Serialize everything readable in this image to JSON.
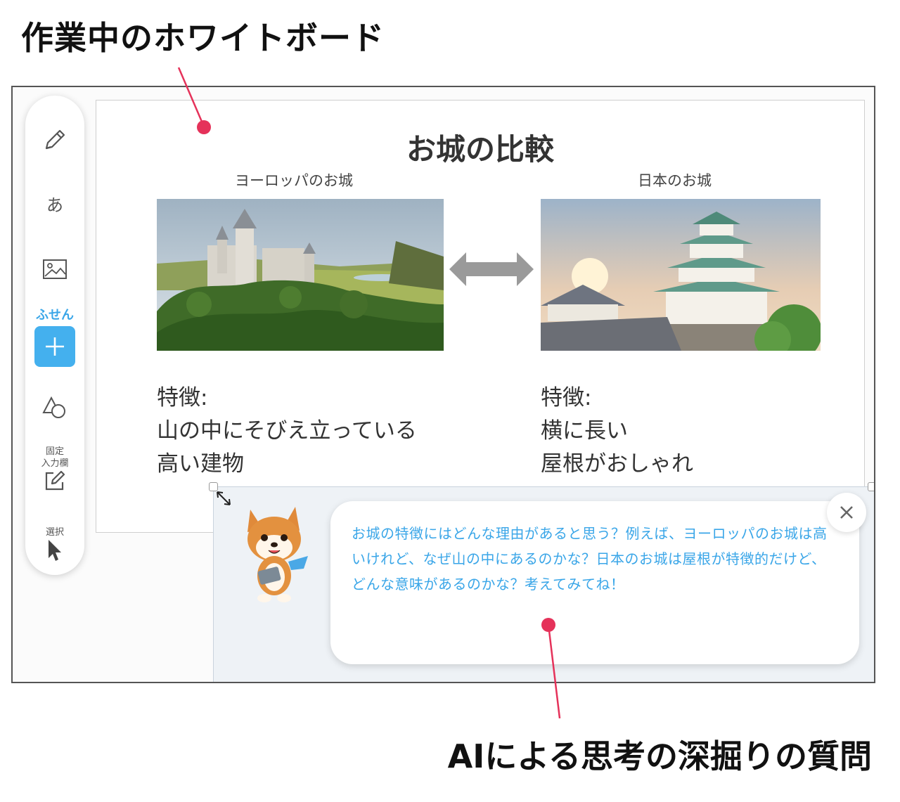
{
  "callouts": {
    "whiteboard": "作業中のホワイトボード",
    "ai_question": "AIによる思考の深掘りの質問"
  },
  "toolbar": {
    "text_tool_label": "あ",
    "fusen_label": "ふせん",
    "fixed_input_label_1": "固定",
    "fixed_input_label_2": "入力欄",
    "select_label": "選択"
  },
  "board": {
    "title": "お城の比較",
    "left": {
      "caption": "ヨーロッパのお城",
      "feature_heading": "特徴:",
      "feature_line_1": "山の中にそびえ立っている",
      "feature_line_2": "高い建物"
    },
    "right": {
      "caption": "日本のお城",
      "feature_heading": "特徴:",
      "feature_line_1": "横に長い",
      "feature_line_2": "屋根がおしゃれ"
    }
  },
  "ai_panel": {
    "message": "お城の特徴にはどんな理由があると思う？例えば、ヨーロッパのお城は高いけれど、なぜ山の中にあるのかな？日本のお城は屋根が特徴的だけど、どんな意味があるのかな？考えてみてね！"
  },
  "icons": {
    "pencil": "pencil-icon",
    "image": "image-icon",
    "plus": "plus-icon",
    "shapes": "shapes-icon",
    "edit": "edit-icon",
    "cursor": "cursor-icon",
    "close": "close-icon",
    "resize": "resize-icon",
    "mascot": "shiba-mascot"
  },
  "colors": {
    "accent_blue": "#44b0ee",
    "ai_text": "#3aa6e8",
    "pointer_red": "#e5325a"
  }
}
